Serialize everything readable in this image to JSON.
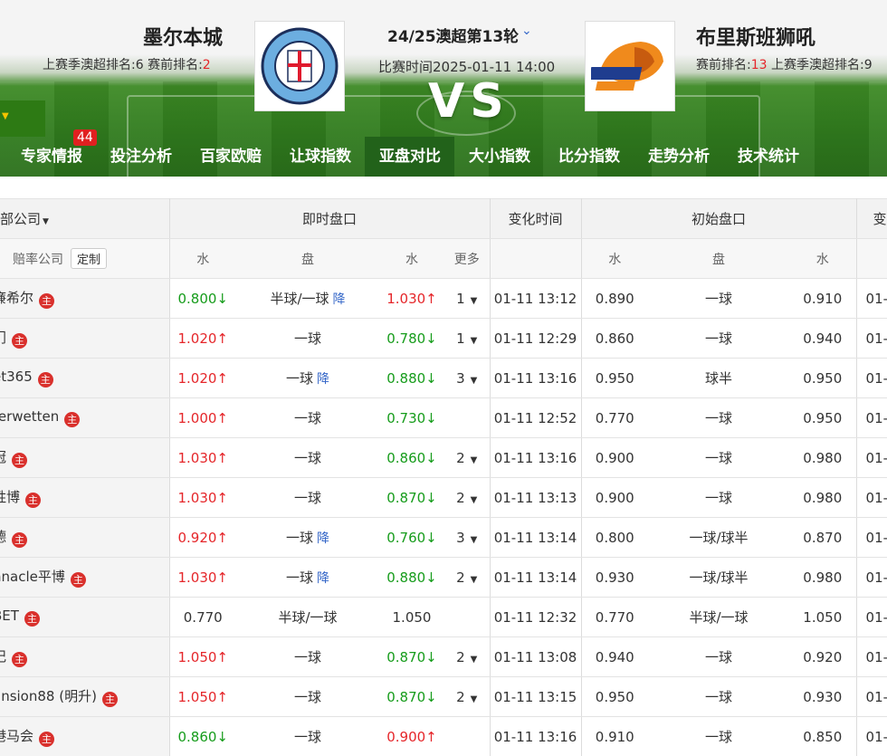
{
  "match": {
    "home_team": "墨尔本城",
    "home_rank_label": "上赛季澳超排名:6  赛前排名:",
    "home_rank_value": "2",
    "away_team": "布里斯班狮吼",
    "away_rank_label1": "赛前排名:",
    "away_rank_value": "13",
    "away_rank_label2": "  上赛季澳超排名:9",
    "round": "24/25澳超第13轮",
    "time": "比赛时间2025-01-11 14:00",
    "vs": "VS"
  },
  "nav": [
    {
      "label": "专家情报",
      "badge": "44"
    },
    {
      "label": "投注分析"
    },
    {
      "label": "百家欧赔"
    },
    {
      "label": "让球指数"
    },
    {
      "label": "亚盘对比",
      "active": true
    },
    {
      "label": "大小指数"
    },
    {
      "label": "比分指数"
    },
    {
      "label": "走势分析"
    },
    {
      "label": "技术统计"
    }
  ],
  "table": {
    "head1": {
      "company": "部公司",
      "live": "即时盘口",
      "change_time": "变化时间",
      "initial": "初始盘口",
      "change2": "变"
    },
    "head2": {
      "company": "赔率公司",
      "custom": "定制",
      "water": "水",
      "pan": "盘",
      "water2": "水",
      "more": "更多",
      "i_water": "水",
      "i_pan": "盘",
      "i_water2": "水"
    },
    "rows": [
      {
        "company": "廉希尔",
        "w1": "0.800↓",
        "w1c": "down",
        "pan": "半球/一球",
        "tag": "降",
        "w2": "1.030↑",
        "w2c": "up",
        "more": "1",
        "time": "01-11 13:12",
        "iw1": "0.890",
        "ipan": "一球",
        "iw2": "0.910",
        "c2": "01-"
      },
      {
        "company": "门",
        "w1": "1.020↑",
        "w1c": "up",
        "pan": "一球",
        "tag": "",
        "w2": "0.780↓",
        "w2c": "down",
        "more": "1",
        "time": "01-11 12:29",
        "iw1": "0.860",
        "ipan": "一球",
        "iw2": "0.940",
        "c2": "01-"
      },
      {
        "company": "et365",
        "w1": "1.020↑",
        "w1c": "up",
        "pan": "一球",
        "tag": "降",
        "w2": "0.880↓",
        "w2c": "down",
        "more": "3",
        "time": "01-11 13:16",
        "iw1": "0.950",
        "ipan": "球半",
        "iw2": "0.950",
        "c2": "01-"
      },
      {
        "company": "terwetten",
        "w1": "1.000↑",
        "w1c": "up",
        "pan": "一球",
        "tag": "",
        "w2": "0.730↓",
        "w2c": "down",
        "more": "",
        "time": "01-11 12:52",
        "iw1": "0.770",
        "ipan": "一球",
        "iw2": "0.950",
        "c2": "01-"
      },
      {
        "company": "冠",
        "w1": "1.030↑",
        "w1c": "up",
        "pan": "一球",
        "tag": "",
        "w2": "0.860↓",
        "w2c": "down",
        "more": "2",
        "time": "01-11 13:16",
        "iw1": "0.900",
        "ipan": "一球",
        "iw2": "0.980",
        "c2": "01-"
      },
      {
        "company": "胜博",
        "w1": "1.030↑",
        "w1c": "up",
        "pan": "一球",
        "tag": "",
        "w2": "0.870↓",
        "w2c": "down",
        "more": "2",
        "time": "01-11 13:13",
        "iw1": "0.900",
        "ipan": "一球",
        "iw2": "0.980",
        "c2": "01-"
      },
      {
        "company": "德",
        "w1": "0.920↑",
        "w1c": "up",
        "pan": "一球",
        "tag": "降",
        "w2": "0.760↓",
        "w2c": "down",
        "more": "3",
        "time": "01-11 13:14",
        "iw1": "0.800",
        "ipan": "一球/球半",
        "iw2": "0.870",
        "c2": "01-"
      },
      {
        "company": "nnacle平博",
        "w1": "1.030↑",
        "w1c": "up",
        "pan": "一球",
        "tag": "降",
        "w2": "0.880↓",
        "w2c": "down",
        "more": "2",
        "time": "01-11 13:14",
        "iw1": "0.930",
        "ipan": "一球/球半",
        "iw2": "0.980",
        "c2": "01-"
      },
      {
        "company": "BET",
        "w1": "0.770",
        "w1c": "flat",
        "pan": "半球/一球",
        "tag": "",
        "w2": "1.050",
        "w2c": "flat",
        "more": "",
        "time": "01-11 12:32",
        "iw1": "0.770",
        "ipan": "半球/一球",
        "iw2": "1.050",
        "c2": "01-"
      },
      {
        "company": "记",
        "w1": "1.050↑",
        "w1c": "up",
        "pan": "一球",
        "tag": "",
        "w2": "0.870↓",
        "w2c": "down",
        "more": "2",
        "time": "01-11 13:08",
        "iw1": "0.940",
        "ipan": "一球",
        "iw2": "0.920",
        "c2": "01-"
      },
      {
        "company": "ansion88 (明升)",
        "w1": "1.050↑",
        "w1c": "up",
        "pan": "一球",
        "tag": "",
        "w2": "0.870↓",
        "w2c": "down",
        "more": "2",
        "time": "01-11 13:15",
        "iw1": "0.950",
        "ipan": "一球",
        "iw2": "0.930",
        "c2": "01-"
      },
      {
        "company": "港马会",
        "w1": "0.860↓",
        "w1c": "down",
        "pan": "一球",
        "tag": "",
        "w2": "0.900↑",
        "w2c": "up",
        "more": "",
        "time": "01-11 13:16",
        "iw1": "0.910",
        "ipan": "一球",
        "iw2": "0.850",
        "c2": "01-"
      }
    ],
    "host_icon": "主"
  },
  "colors": {
    "up": "#e5262a",
    "down": "#169c1b",
    "accent": "#3567c8",
    "nav_bg": "#2f7a1d"
  }
}
